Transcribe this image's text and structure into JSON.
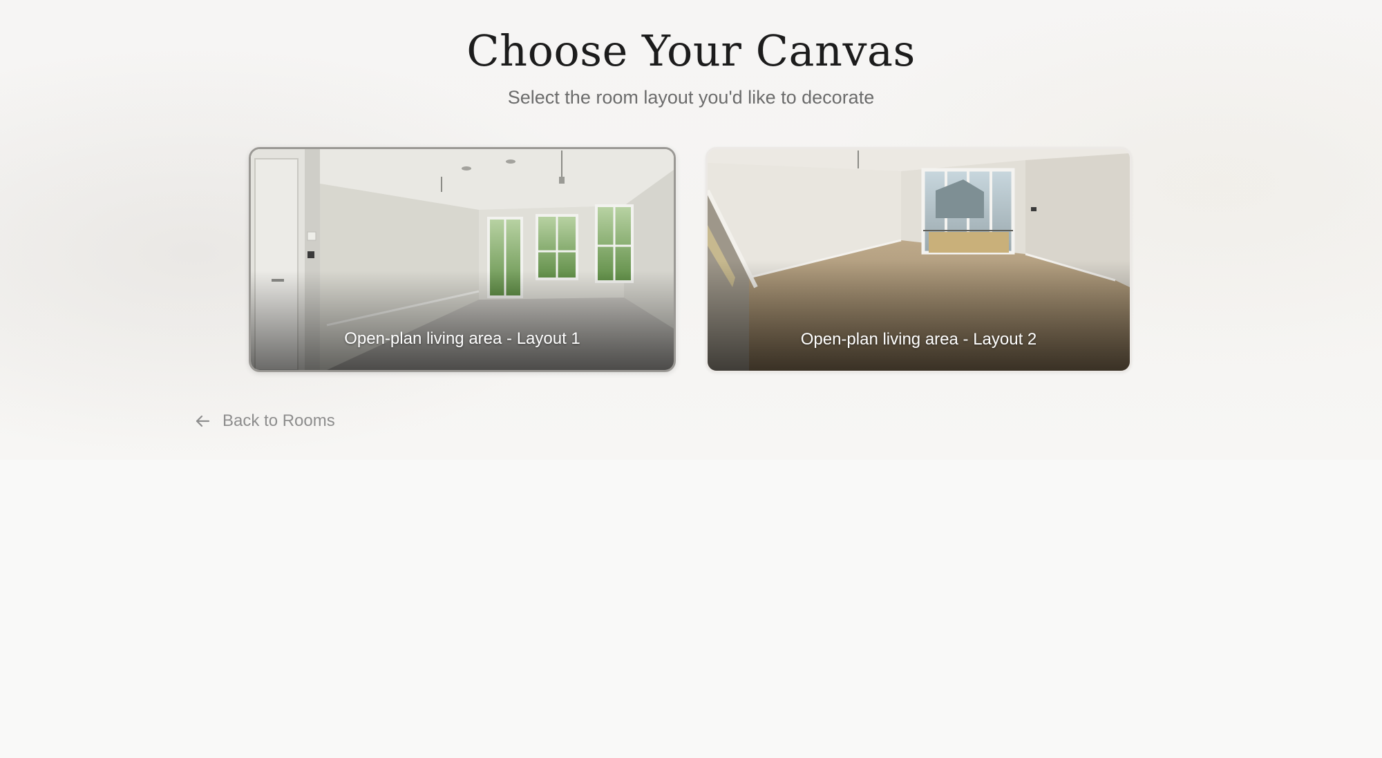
{
  "page": {
    "title": "Choose Your Canvas",
    "subtitle": "Select the room layout you'd like to decorate"
  },
  "layouts": [
    {
      "label": "Open-plan living area - Layout 1",
      "selected": true
    },
    {
      "label": "Open-plan living area - Layout 2",
      "selected": false
    }
  ],
  "nav": {
    "back_label": "Back to Rooms",
    "back_icon": "arrow-left-icon"
  },
  "colors": {
    "title": "#1c1c1c",
    "subtitle": "#6b6b6b",
    "link": "#8d8d8d",
    "selected_border": "#9a9894"
  }
}
